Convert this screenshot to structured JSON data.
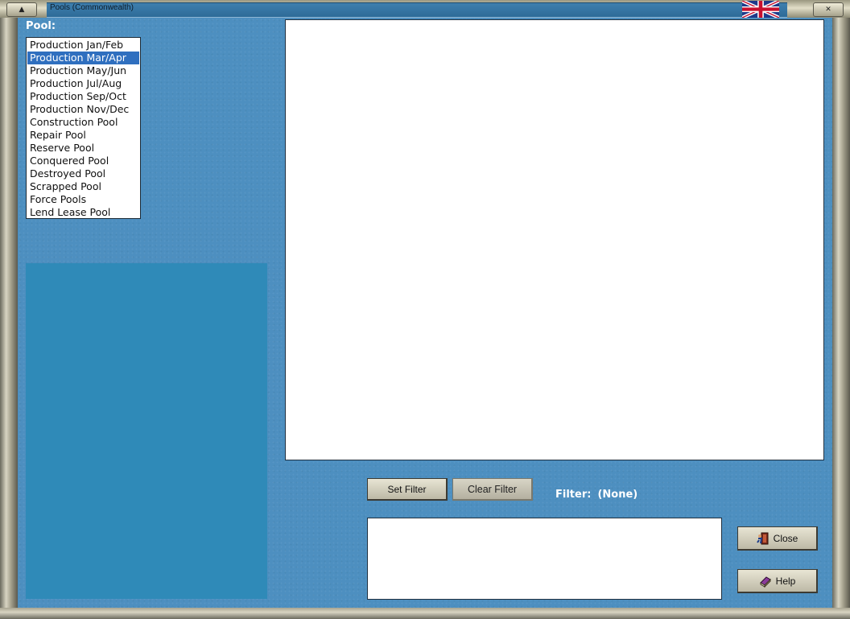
{
  "window": {
    "title": "Pools (Commonwealth)",
    "flag_icon": "uk-flag-icon"
  },
  "pool_section": {
    "label": "Pool:",
    "items": [
      "Production Jan/Feb",
      "Production Mar/Apr",
      "Production May/Jun",
      "Production Jul/Aug",
      "Production Sep/Oct",
      "Production Nov/Dec",
      "Construction Pool",
      "Repair Pool",
      "Reserve Pool",
      "Conquered Pool",
      "Destroyed Pool",
      "Scrapped Pool",
      "Force Pools",
      "Lend Lease Pool"
    ],
    "selected_index": 1
  },
  "filter": {
    "set_label": "Set Filter",
    "clear_label": "Clear Filter",
    "label": "Filter:",
    "value": "(None)"
  },
  "buttons": {
    "close_label": "Close",
    "help_label": "Help"
  },
  "colors": {
    "client_bg": "#4d8fc0",
    "panel_bg": "#2f8ab8",
    "selection": "#2f6fbf"
  }
}
